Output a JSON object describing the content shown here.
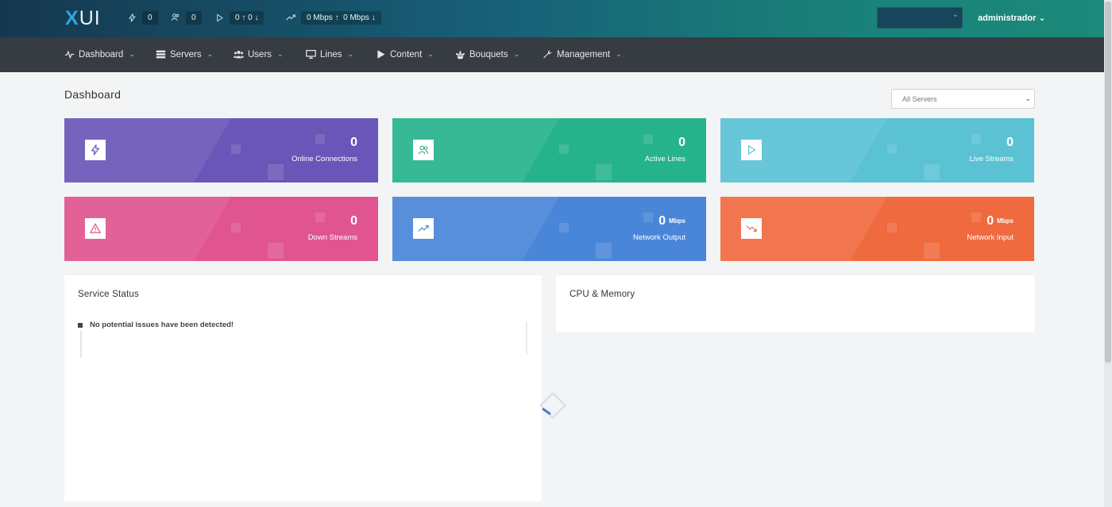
{
  "brand": {
    "x": "X",
    "ui": "UI"
  },
  "topbar": {
    "connections": "0",
    "users": "0",
    "streams_up": "0",
    "streams_down": "0",
    "net_out": "0 Mbps",
    "net_in": "0 Mbps",
    "user": "administrador"
  },
  "nav": [
    {
      "label": "Dashboard",
      "icon": "activity-icon"
    },
    {
      "label": "Servers",
      "icon": "server-icon"
    },
    {
      "label": "Users",
      "icon": "users-icon"
    },
    {
      "label": "Lines",
      "icon": "monitor-icon"
    },
    {
      "label": "Content",
      "icon": "play-icon"
    },
    {
      "label": "Bouquets",
      "icon": "flower-icon"
    },
    {
      "label": "Management",
      "icon": "wrench-icon"
    }
  ],
  "page": {
    "title": "Dashboard",
    "server_filter": "All Servers"
  },
  "cards": [
    {
      "value": "0",
      "unit": "",
      "label": "Online Connections",
      "color": "#6a56b8",
      "icon": "bolt-icon"
    },
    {
      "value": "0",
      "unit": "",
      "label": "Active Lines",
      "color": "#26b38c",
      "icon": "users-icon"
    },
    {
      "value": "0",
      "unit": "",
      "label": "Live Streams",
      "color": "#5bc2d4",
      "icon": "play-icon"
    },
    {
      "value": "0",
      "unit": "",
      "label": "Down Streams",
      "color": "#e0558f",
      "icon": "warning-icon"
    },
    {
      "value": "0",
      "unit": "Mbps",
      "label": "Network Output",
      "color": "#4a86d8",
      "icon": "trend-up-icon"
    },
    {
      "value": "0",
      "unit": "Mbps",
      "label": "Network Input",
      "color": "#f06a3f",
      "icon": "trend-down-icon"
    }
  ],
  "panels": {
    "service_status": {
      "title": "Service Status",
      "message": "No potential issues have been detected!"
    },
    "cpu_memory": {
      "title": "CPU & Memory"
    }
  }
}
